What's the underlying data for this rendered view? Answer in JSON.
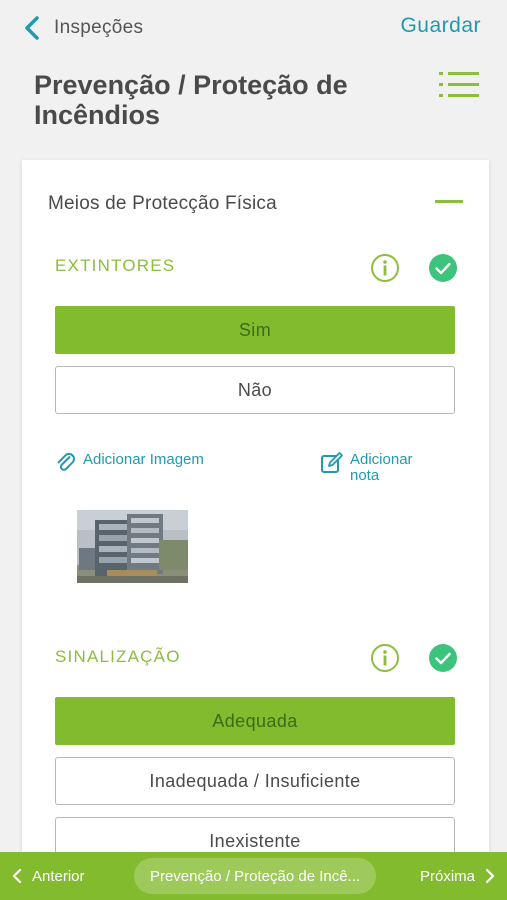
{
  "header": {
    "back_label": "Inspeções",
    "save_label": "Guardar",
    "title": "Prevenção / Proteção de Incêndios"
  },
  "section": {
    "title": "Meios de Protecção Física"
  },
  "questions": [
    {
      "label": "EXTINTORES",
      "answered": true,
      "options": [
        {
          "label": "Sim",
          "selected": true
        },
        {
          "label": "Não",
          "selected": false
        }
      ],
      "add_image_label": "Adicionar Imagem",
      "add_note_label": "Adicionar nota"
    },
    {
      "label": "SINALIZAÇÃO",
      "answered": true,
      "options": [
        {
          "label": "Adequada",
          "selected": true
        },
        {
          "label": "Inadequada / Insuficiente",
          "selected": false
        },
        {
          "label": "Inexistente",
          "selected": false
        }
      ]
    }
  ],
  "footer": {
    "prev_label": "Anterior",
    "current_label": "Prevenção / Proteção de Incê...",
    "next_label": "Próxima"
  },
  "colors": {
    "accent_green": "#82bb2e",
    "label_green": "#8cbd3f",
    "teal": "#1f9ab0",
    "check_green": "#3cc47c"
  },
  "icons": [
    "chevron-left-icon",
    "list-menu-icon",
    "info-icon",
    "check-circle-icon",
    "paperclip-icon",
    "edit-note-icon",
    "chevron-right-icon"
  ]
}
